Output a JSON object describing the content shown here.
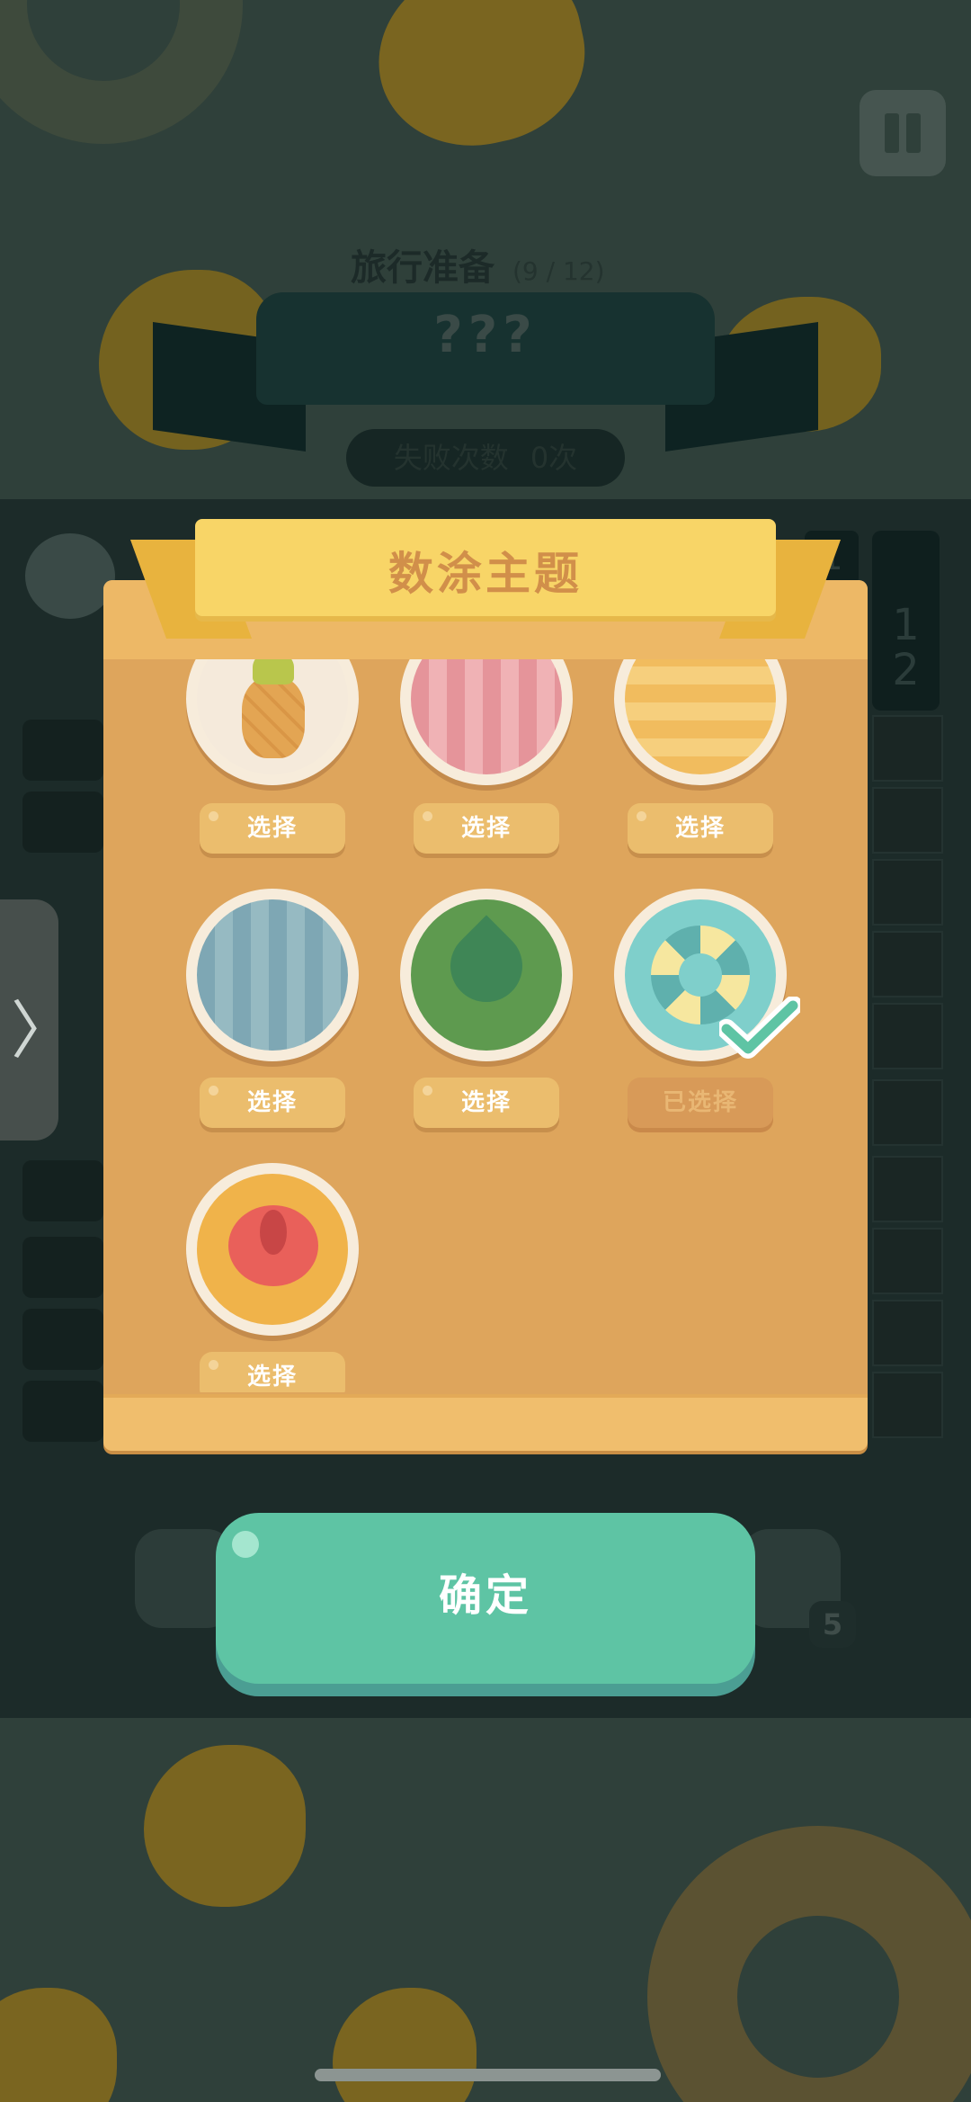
{
  "header": {
    "level_name": "旅行准备",
    "level_progress": "(9 / 12)",
    "puzzle_title": "???",
    "fail_label": "失败次数",
    "fail_count": "0次"
  },
  "board": {
    "right_clue_top": "1",
    "right_clue_lines": [
      "1",
      "2"
    ]
  },
  "modal": {
    "title": "数涂主题",
    "themes": [
      {
        "theme": "pineapple",
        "label": "选择",
        "selected": false
      },
      {
        "theme": "pink-check",
        "label": "选择",
        "selected": false
      },
      {
        "theme": "yellow-check",
        "label": "选择",
        "selected": false
      },
      {
        "theme": "blue-check",
        "label": "选择",
        "selected": false
      },
      {
        "theme": "leaf",
        "label": "选择",
        "selected": false
      },
      {
        "theme": "lifebuoy",
        "label": "已选择",
        "selected": true
      },
      {
        "theme": "hibiscus",
        "label": "选择",
        "selected": false
      }
    ],
    "colors": {
      "panel": "#dea55c",
      "banner": "#f8d567",
      "selected_check": "#5ec4a4"
    }
  },
  "confirm_button": {
    "label": "确定"
  },
  "toolbar": {
    "hint_count": "5"
  },
  "side_tab": {
    "glyph": "〉"
  }
}
